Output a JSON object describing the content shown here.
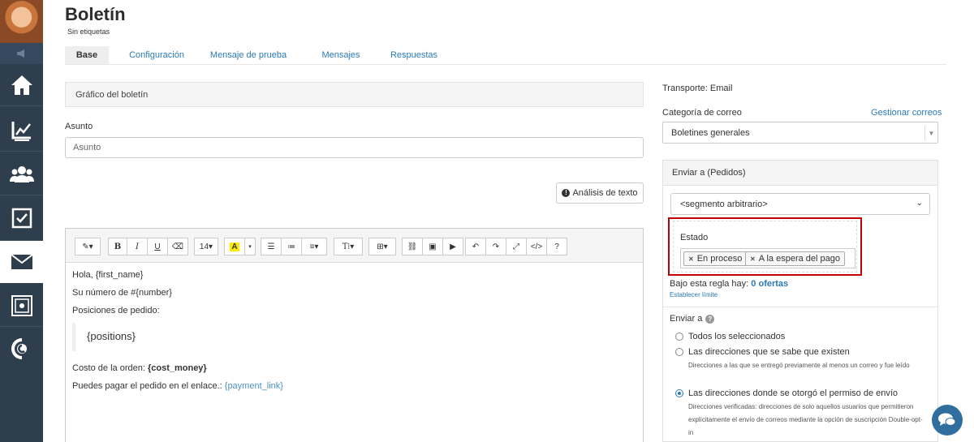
{
  "page": {
    "title": "Boletín",
    "subtitle": "Sin etiquetas"
  },
  "tabs": [
    {
      "label": "Base",
      "active": true
    },
    {
      "label": "Configuración",
      "active": false
    },
    {
      "label": "Mensaje de prueba",
      "active": false
    },
    {
      "label": "Mensajes",
      "active": false
    },
    {
      "label": "Respuestas",
      "active": false
    }
  ],
  "left": {
    "graphic_panel_title": "Gráfico del boletín",
    "subject_label": "Asunto",
    "subject_placeholder": "Asunto",
    "analysis_button": "Análisis de texto",
    "editor": {
      "toolbar": {
        "font_size": "14"
      },
      "lines": {
        "greeting": "Hola, {first_name}",
        "number": "Su número de #{number}",
        "positions_label": "Posiciones de pedido:",
        "positions_quote": "{positions}",
        "cost_prefix": "Costo de la orden: ",
        "cost_value": "{cost_money}",
        "pay_prefix": "Puedes pagar el pedido en el enlace.: ",
        "pay_link": "{payment_link}"
      }
    }
  },
  "right": {
    "transport": "Transporte: Email",
    "category_label": "Categoría de correo",
    "manage_link": "Gestionar correos",
    "category_value": "Boletines generales",
    "send_to_header": "Enviar a (Pedidos)",
    "segment_value": "<segmento arbitrario>",
    "estado_label": "Estado",
    "estado_tags": [
      "En proceso",
      "A la espera del pago"
    ],
    "rule_prefix": "Bajo esta regla hay: ",
    "rule_count": "0 ofertas",
    "limit_link": "Establecer límite",
    "send_to_label": "Enviar a",
    "options": [
      {
        "label": "Todos los seleccionados",
        "checked": false,
        "desc": ""
      },
      {
        "label": "Las direcciones que se sabe que existen",
        "checked": false,
        "desc": "Direcciones a las que se entregó previamente al menos un correo y fue leído"
      },
      {
        "label": "Las direcciones donde se otorgó el permiso de envío",
        "checked": true,
        "desc": "Direcciones verificadas: direcciones de solo aquellos usuarios que permitieron explícitamente el envío de correos mediante la opción de suscripción Double-opt-in"
      }
    ]
  },
  "colors": {
    "sidebar": "#2f3e4d",
    "link": "#2a7ab8",
    "highlight_border": "#c00000"
  },
  "icons": [
    "megaphone-icon",
    "home-icon",
    "chart-icon",
    "users-icon",
    "checkbox-icon",
    "mail-icon",
    "safe-icon",
    "c-logo-icon",
    "chat-icon"
  ]
}
